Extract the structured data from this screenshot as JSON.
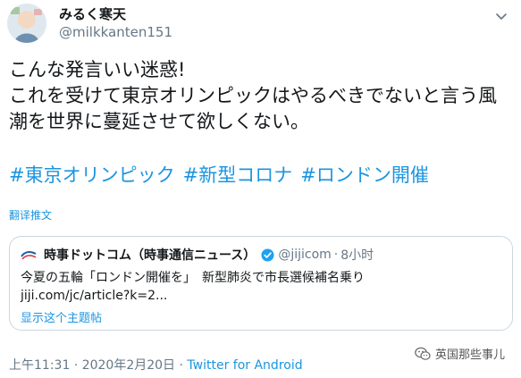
{
  "user": {
    "display_name": "みるく寒天",
    "handle": "@milkkanten151"
  },
  "tweet": {
    "text": "こんな発言いい迷惑!\nこれを受けて東京オリンピックはやるべきでないと言う風潮を世界に蔓延させて欲しくない。",
    "hashtags": [
      "#東京オリンピック",
      "#新型コロナ",
      "#ロンドン開催"
    ],
    "translate_label": "翻译推文"
  },
  "quoted": {
    "name": "時事ドットコム（時事通信ニュース）",
    "handle": "@jijicom",
    "separator": "·",
    "time": "8小时",
    "text": "今夏の五輪「ロンドン開催を」　新型肺炎で市長選候補名乗り",
    "link": "jiji.com/jc/article?k=2...",
    "show_thread_label": "显示这个主题帖"
  },
  "footer": {
    "time_date": "上午11:31 · 2020年2月20日 · ",
    "client": "Twitter for Android"
  },
  "watermark": {
    "text": "英国那些事儿",
    "icon": "wechat-icon"
  },
  "colors": {
    "link_blue": "#1b95e0",
    "secondary_text": "#657786",
    "border": "#ccd6dd",
    "verified": "#1da1f2"
  }
}
